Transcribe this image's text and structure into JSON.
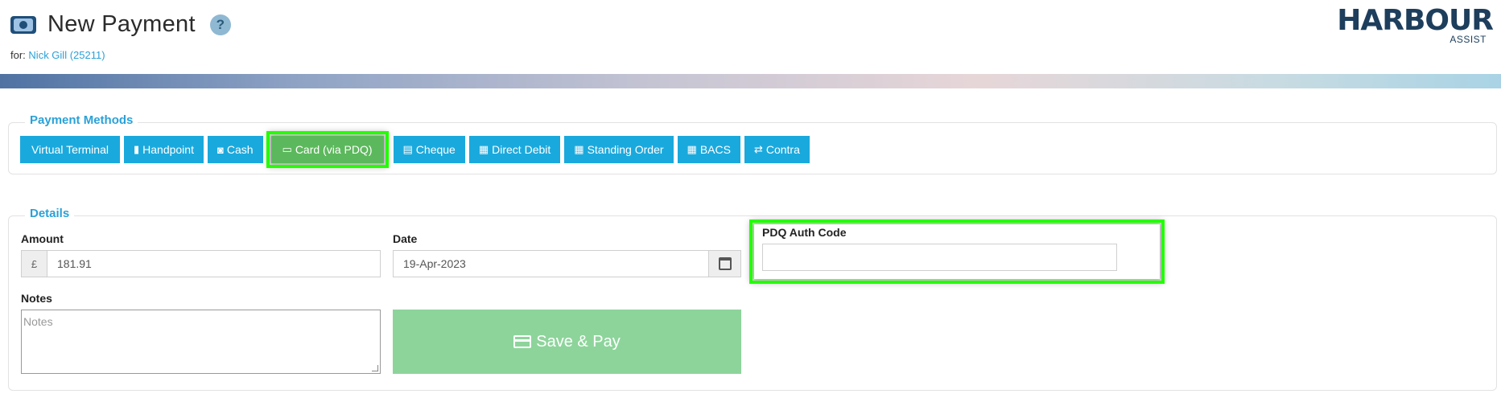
{
  "header": {
    "title": "New Payment",
    "help_glyph": "?",
    "for_prefix": "for:",
    "customer": "Nick Gill (25211)"
  },
  "logo": {
    "main": "HARBOUR",
    "sub": "ASSIST"
  },
  "payment_methods": {
    "legend": "Payment Methods",
    "buttons": [
      {
        "label": "Virtual Terminal",
        "icon": ""
      },
      {
        "label": "Handpoint",
        "icon": "mobile-icon"
      },
      {
        "label": "Cash",
        "icon": "cash-icon"
      },
      {
        "label": "Card (via PDQ)",
        "icon": "credit-card-icon",
        "active": true
      },
      {
        "label": "Cheque",
        "icon": "cheque-icon"
      },
      {
        "label": "Direct Debit",
        "icon": "calendar-icon"
      },
      {
        "label": "Standing Order",
        "icon": "calendar-icon"
      },
      {
        "label": "BACS",
        "icon": "calendar-icon"
      },
      {
        "label": "Contra",
        "icon": "exchange-icon"
      }
    ]
  },
  "details": {
    "legend": "Details",
    "amount_label": "Amount",
    "currency": "£",
    "amount_value": "181.91",
    "date_label": "Date",
    "date_value": "19-Apr-2023",
    "pdq_label": "PDQ Auth Code",
    "pdq_value": "",
    "notes_label": "Notes",
    "notes_placeholder": "Notes",
    "save_label": "Save & Pay"
  },
  "colors": {
    "primary_button": "#1aa9dd",
    "active_button": "#5cb85c",
    "save_button": "#8dd49b",
    "highlight": "#22ff00",
    "legend_text": "#2aa1d8"
  }
}
